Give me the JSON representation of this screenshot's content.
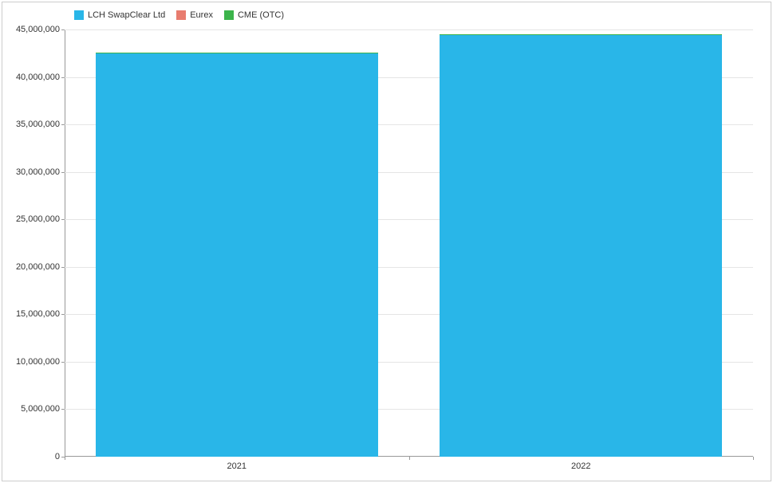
{
  "legend": {
    "items": [
      {
        "label": "LCH SwapClear Ltd",
        "color": "#29b6e8"
      },
      {
        "label": "Eurex",
        "color": "#e87c6f"
      },
      {
        "label": "CME (OTC)",
        "color": "#3cb44b"
      }
    ]
  },
  "y_axis": {
    "ticks": [
      {
        "value": 0,
        "label": "0"
      },
      {
        "value": 5000000,
        "label": "5,000,000"
      },
      {
        "value": 10000000,
        "label": "10,000,000"
      },
      {
        "value": 15000000,
        "label": "15,000,000"
      },
      {
        "value": 20000000,
        "label": "20,000,000"
      },
      {
        "value": 25000000,
        "label": "25,000,000"
      },
      {
        "value": 30000000,
        "label": "30,000,000"
      },
      {
        "value": 35000000,
        "label": "35,000,000"
      },
      {
        "value": 40000000,
        "label": "40,000,000"
      },
      {
        "value": 45000000,
        "label": "45,000,000"
      }
    ],
    "max": 45000000
  },
  "x_axis": {
    "categories": [
      "2021",
      "2022"
    ]
  },
  "chart_data": {
    "type": "bar",
    "categories": [
      "2021",
      "2022"
    ],
    "series": [
      {
        "name": "LCH SwapClear Ltd",
        "color": "#29b6e8",
        "values": [
          42500000,
          44400000
        ]
      },
      {
        "name": "Eurex",
        "color": "#e87c6f",
        "values": [
          70000,
          70000
        ]
      },
      {
        "name": "CME (OTC)",
        "color": "#3cb44b",
        "values": [
          30000,
          30000
        ]
      }
    ],
    "title": "",
    "xlabel": "",
    "ylabel": "",
    "ylim": [
      0,
      45000000
    ]
  }
}
